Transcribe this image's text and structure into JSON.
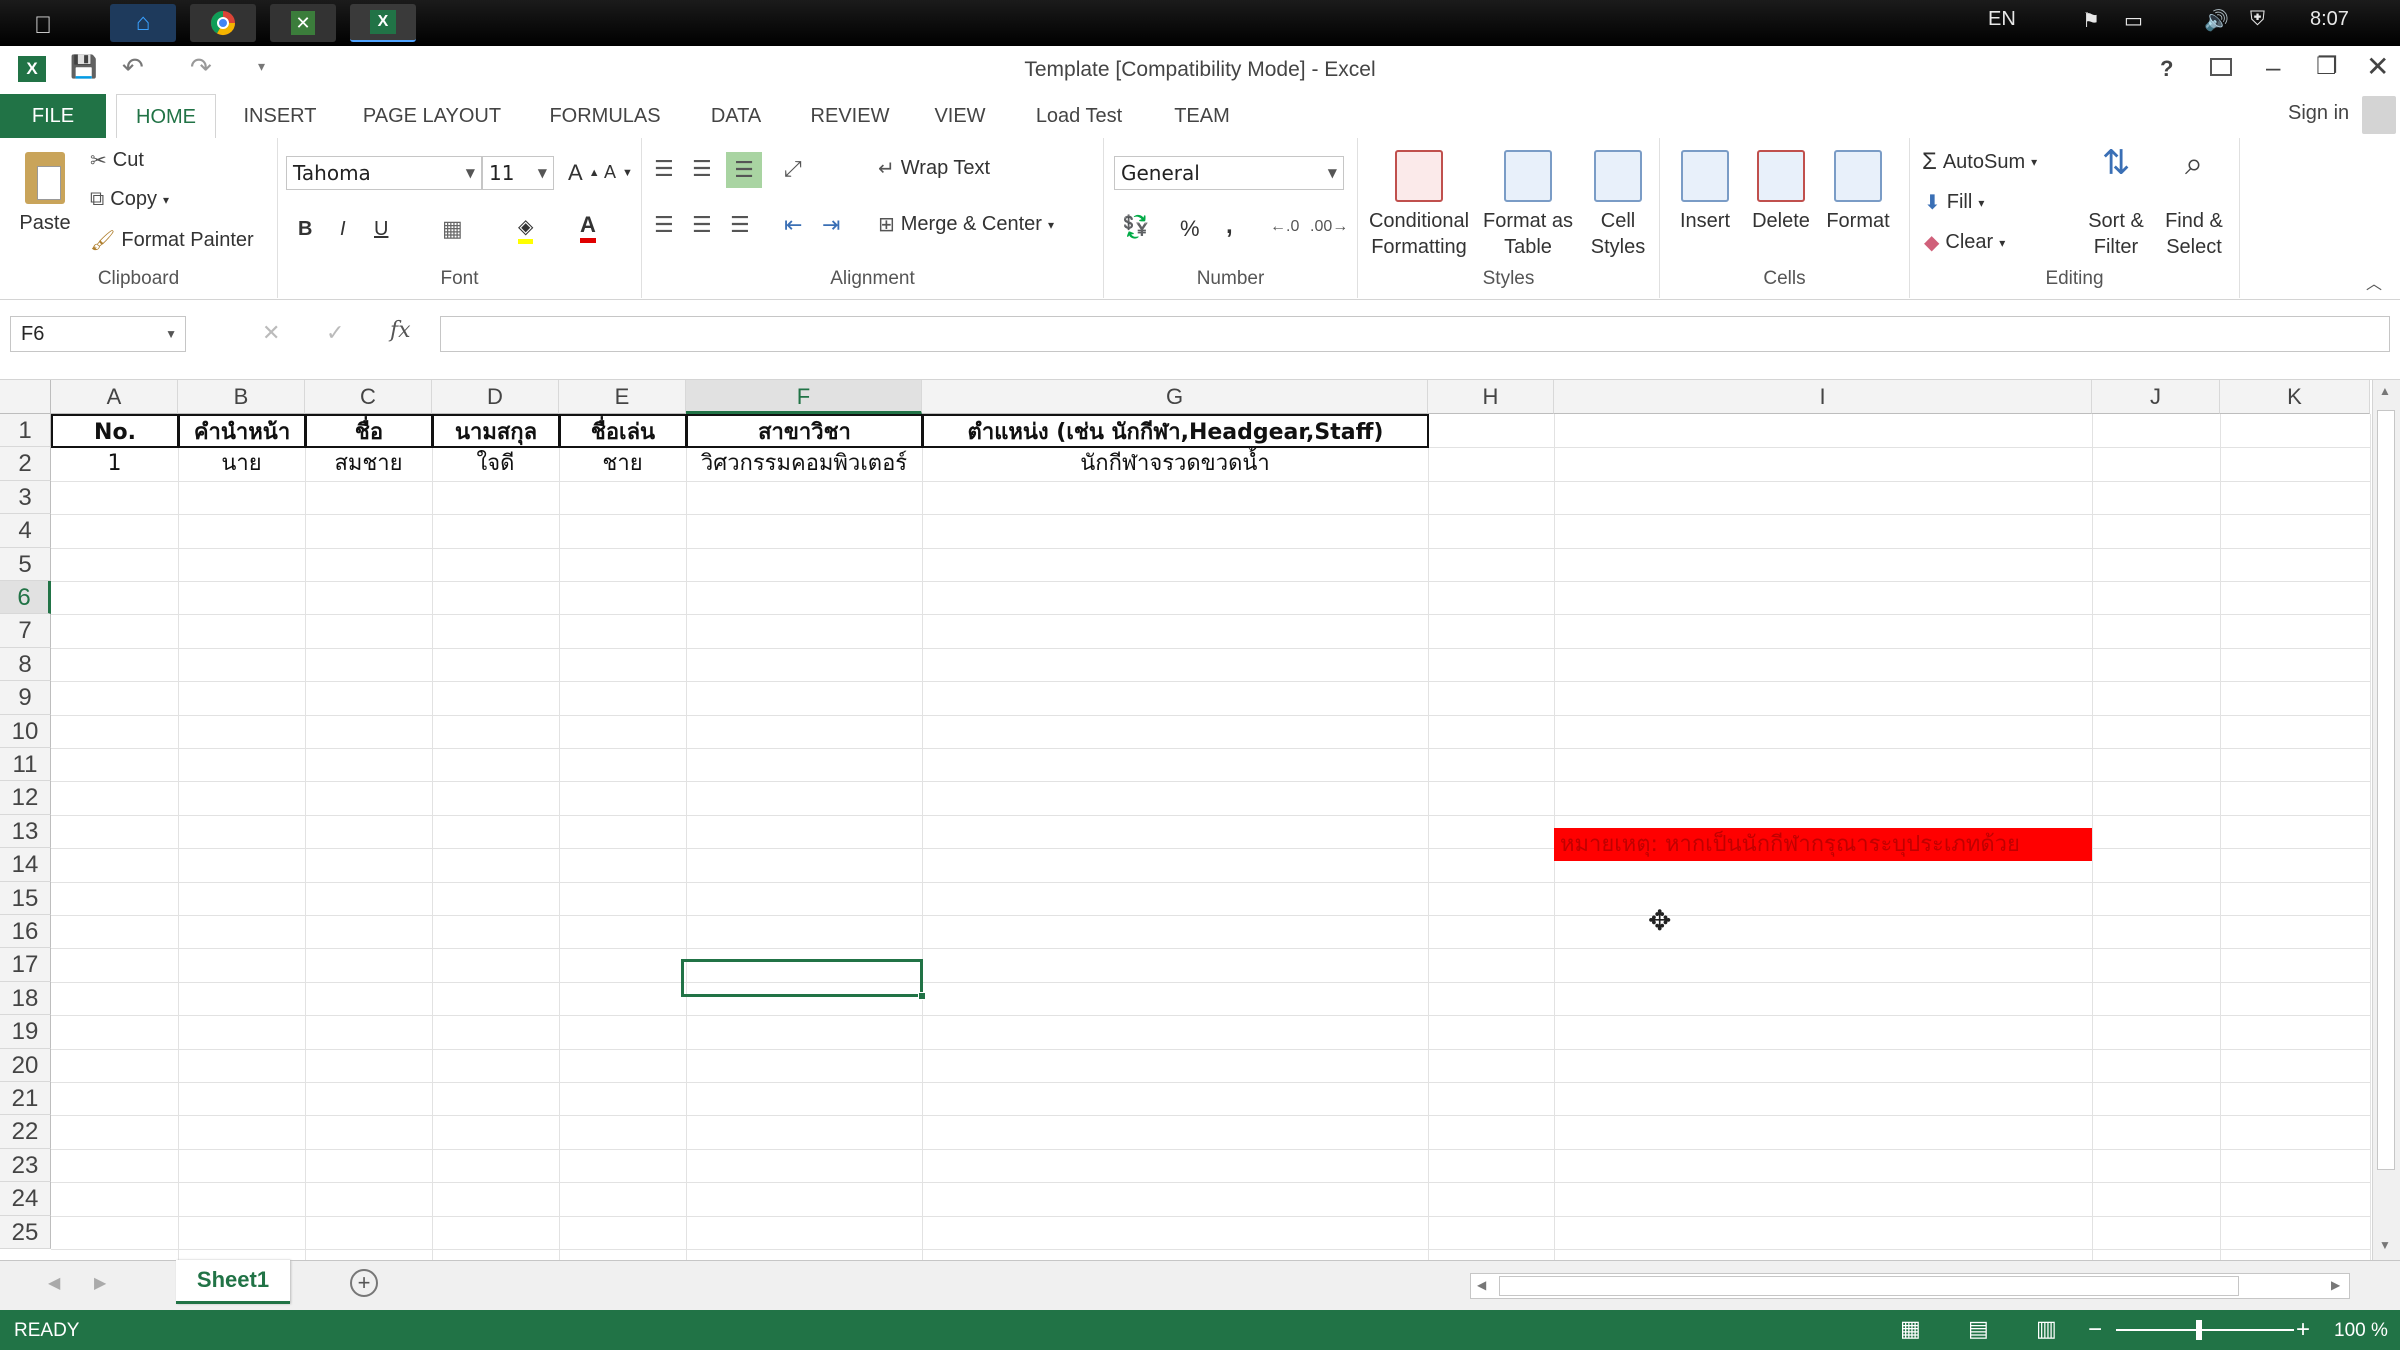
{
  "taskbar": {
    "lang": "EN",
    "time": "8:07"
  },
  "window": {
    "title": "Template  [Compatibility Mode] - Excel",
    "help": "?",
    "sign_in": "Sign in"
  },
  "ribbon_tabs": [
    "FILE",
    "HOME",
    "INSERT",
    "PAGE LAYOUT",
    "FORMULAS",
    "DATA",
    "REVIEW",
    "VIEW",
    "Load Test",
    "TEAM"
  ],
  "active_tab": "HOME",
  "clipboard": {
    "paste": "Paste",
    "cut": "Cut",
    "copy": "Copy",
    "format_painter": "Format Painter",
    "label": "Clipboard"
  },
  "font": {
    "name": "Tahoma",
    "size": "11",
    "label": "Font",
    "bold": "B",
    "italic": "I",
    "underline": "U"
  },
  "alignment": {
    "wrap_text": "Wrap Text",
    "merge_center": "Merge & Center",
    "label": "Alignment"
  },
  "number": {
    "format": "General",
    "percent": "%",
    "comma": ",",
    "label": "Number"
  },
  "styles": {
    "conditional_1": "Conditional",
    "conditional_2": "Formatting",
    "format_table_1": "Format as",
    "format_table_2": "Table",
    "cell_styles_1": "Cell",
    "cell_styles_2": "Styles",
    "label": "Styles"
  },
  "cells": {
    "insert": "Insert",
    "delete": "Delete",
    "format": "Format",
    "label": "Cells"
  },
  "editing": {
    "autosum": "AutoSum",
    "fill": "Fill",
    "clear": "Clear",
    "sort_1": "Sort &",
    "sort_2": "Filter",
    "find_1": "Find &",
    "find_2": "Select",
    "label": "Editing"
  },
  "formula_bar": {
    "name_box": "F6",
    "fx": "fx",
    "value": ""
  },
  "columns": [
    "A",
    "B",
    "C",
    "D",
    "E",
    "F",
    "G",
    "H",
    "I",
    "J",
    "K"
  ],
  "selected_column": "F",
  "rows": [
    "1",
    "2",
    "3",
    "4",
    "5",
    "6",
    "7",
    "8",
    "9",
    "10",
    "11",
    "12",
    "13",
    "14",
    "15",
    "16",
    "17",
    "18",
    "19",
    "20",
    "21",
    "22",
    "23",
    "24",
    "25"
  ],
  "selected_row": "6",
  "headers": [
    "No.",
    "คำนำหน้า",
    "ชื่อ",
    "นามสกุล",
    "ชื่อเล่น",
    "สาขาวิชา",
    "ตำแหน่ง (เช่น นักกีฬา,Headgear,Staff)"
  ],
  "row2": [
    "1",
    "นาย",
    "สมชาย",
    "ใจดี",
    "ชาย",
    "วิศวกรรมคอมพิวเตอร์",
    "นักกีฬาจรวดขวดน้ำ"
  ],
  "note": "หมายเหตุ: หากเป็นนักกีฬากรุณาระบุประเภทด้วย",
  "colors": {
    "excel_green": "#217346",
    "note_fill": "#ff0000"
  },
  "sheet_tabs": [
    "Sheet1"
  ],
  "status": {
    "ready": "READY",
    "zoom": "100 %"
  }
}
